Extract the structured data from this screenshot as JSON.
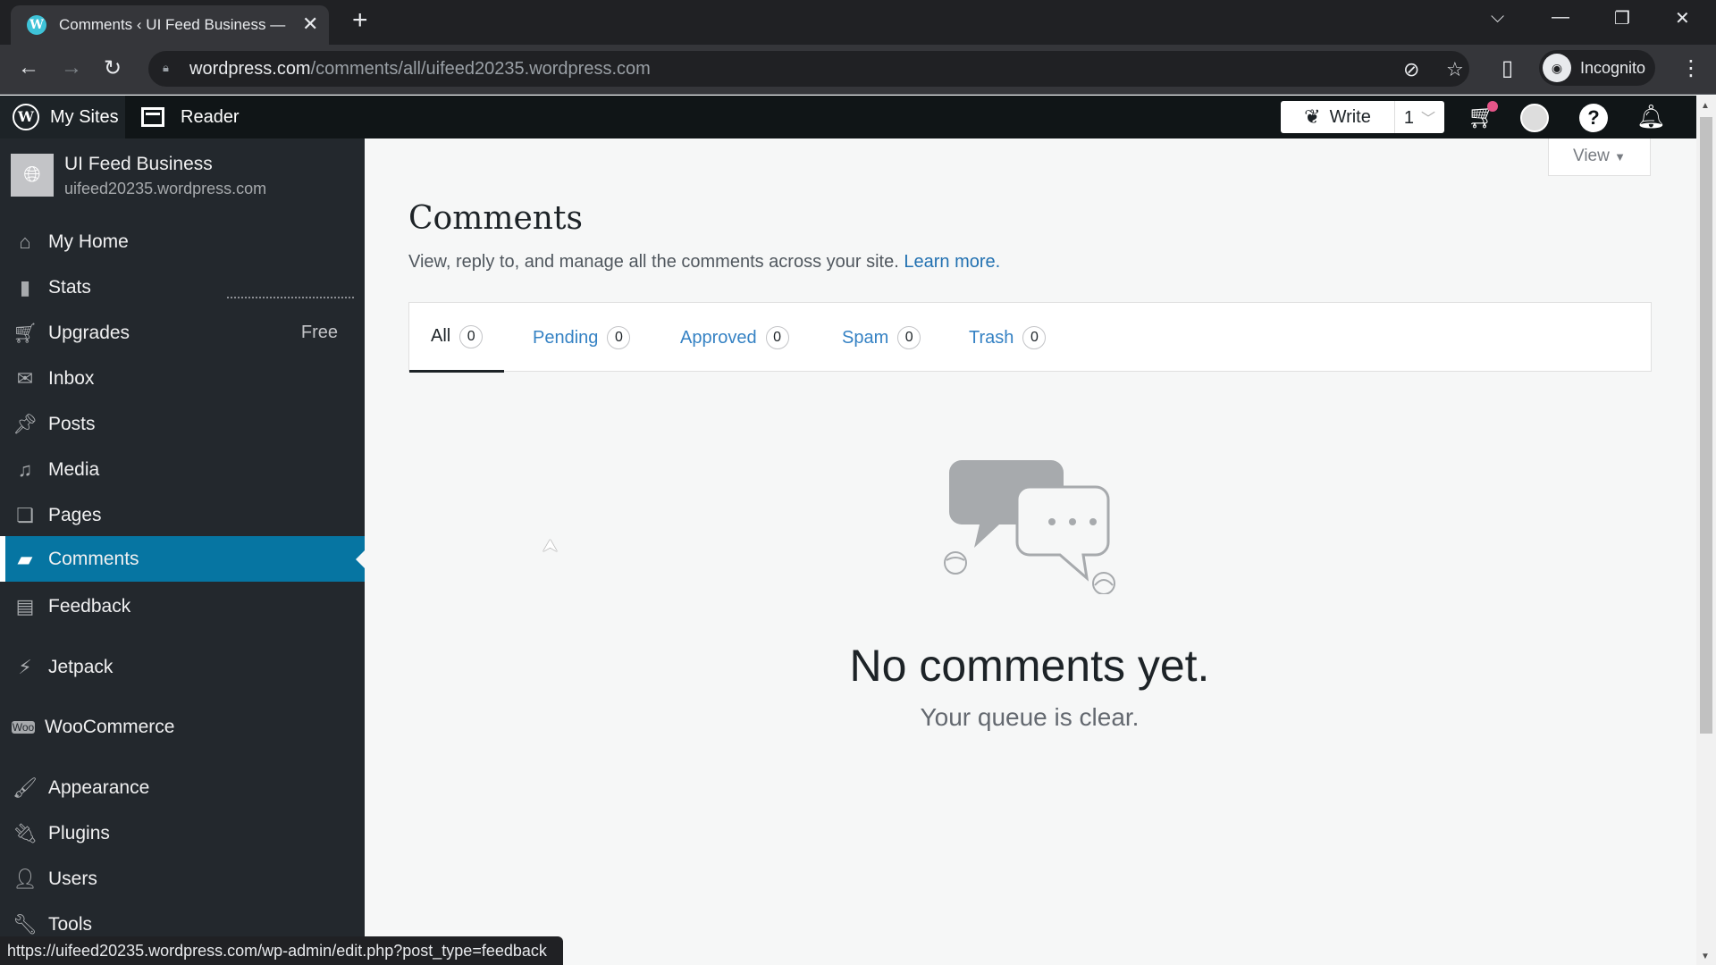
{
  "browser": {
    "tab_title": "Comments ‹ UI Feed Business —",
    "new_tab": "+",
    "url_domain": "wordpress.com",
    "url_path": "/comments/all/uifeed20235.wordpress.com",
    "profile_label": "Incognito",
    "status_url": "https://uifeed20235.wordpress.com/wp-admin/edit.php?post_type=feedback"
  },
  "masterbar": {
    "my_sites": "My Sites",
    "reader": "Reader",
    "write": "Write",
    "site_count": "1",
    "colors": {
      "notification_dot": "#e65588"
    }
  },
  "site": {
    "name": "UI Feed Business",
    "domain": "uifeed20235.wordpress.com"
  },
  "sidebar": {
    "items": [
      {
        "label": "My Home",
        "icon": "home-icon"
      },
      {
        "label": "Stats",
        "icon": "stats-icon"
      },
      {
        "label": "Upgrades",
        "icon": "cart-icon",
        "badge": "Free"
      },
      {
        "label": "Inbox",
        "icon": "mail-icon"
      },
      {
        "label": "Posts",
        "icon": "pin-icon"
      },
      {
        "label": "Media",
        "icon": "media-icon"
      },
      {
        "label": "Pages",
        "icon": "pages-icon"
      },
      {
        "label": "Comments",
        "icon": "comment-icon",
        "active": true
      },
      {
        "label": "Feedback",
        "icon": "feedback-icon"
      },
      {
        "label": "Jetpack",
        "icon": "jetpack-icon"
      },
      {
        "label": "WooCommerce",
        "icon": "woo-icon"
      },
      {
        "label": "Appearance",
        "icon": "brush-icon"
      },
      {
        "label": "Plugins",
        "icon": "plug-icon"
      },
      {
        "label": "Users",
        "icon": "user-icon"
      },
      {
        "label": "Tools",
        "icon": "wrench-icon"
      }
    ],
    "colors": {
      "active_bg": "#0675a2"
    }
  },
  "main": {
    "view_button": "View",
    "title": "Comments",
    "subtitle": "View, reply to, and manage all the comments across your site.",
    "learn_more": "Learn more.",
    "tabs": [
      {
        "label": "All",
        "count": "0",
        "selected": true
      },
      {
        "label": "Pending",
        "count": "0"
      },
      {
        "label": "Approved",
        "count": "0"
      },
      {
        "label": "Spam",
        "count": "0"
      },
      {
        "label": "Trash",
        "count": "0"
      }
    ],
    "empty_title": "No comments yet.",
    "empty_subtitle": "Your queue is clear."
  }
}
